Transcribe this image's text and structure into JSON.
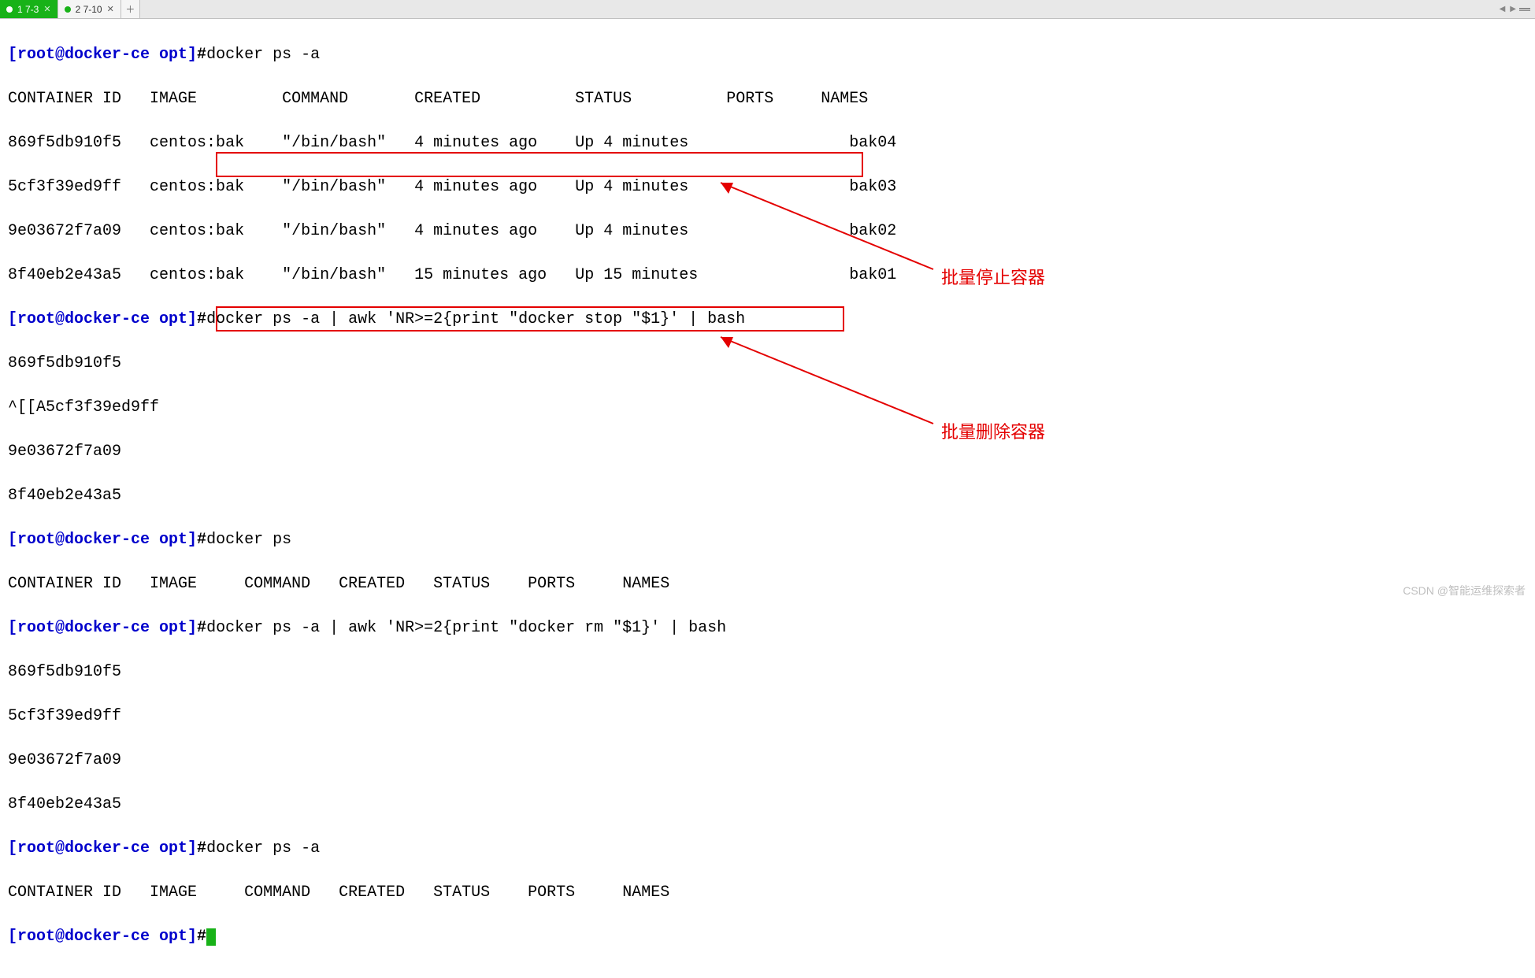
{
  "tabs": {
    "items": [
      {
        "label": "1 7-3",
        "active": true
      },
      {
        "label": "2 7-10",
        "active": false
      }
    ]
  },
  "prompt": "[root@docker-ce opt]",
  "hash": "#",
  "commands": {
    "ps_a_1": "docker ps -a",
    "stop_pipe": "docker ps -a | awk 'NR>=2{print \"docker stop \"$1}' | bash",
    "ps": "docker ps",
    "rm_pipe": "docker ps -a | awk 'NR>=2{print \"docker rm \"$1}' | bash",
    "ps_a_2": "docker ps -a"
  },
  "headers_full": {
    "cid": "CONTAINER ID",
    "image": "IMAGE",
    "cmd": "COMMAND",
    "created": "CREATED",
    "status": "STATUS",
    "ports": "PORTS",
    "names": "NAMES"
  },
  "rows": [
    {
      "cid": "869f5db910f5",
      "image": "centos:bak",
      "cmd": "\"/bin/bash\"",
      "created": "4 minutes ago",
      "status": "Up 4 minutes",
      "ports": "",
      "names": "bak04"
    },
    {
      "cid": "5cf3f39ed9ff",
      "image": "centos:bak",
      "cmd": "\"/bin/bash\"",
      "created": "4 minutes ago",
      "status": "Up 4 minutes",
      "ports": "",
      "names": "bak03"
    },
    {
      "cid": "9e03672f7a09",
      "image": "centos:bak",
      "cmd": "\"/bin/bash\"",
      "created": "4 minutes ago",
      "status": "Up 4 minutes",
      "ports": "",
      "names": "bak02"
    },
    {
      "cid": "8f40eb2e43a5",
      "image": "centos:bak",
      "cmd": "\"/bin/bash\"",
      "created": "15 minutes ago",
      "status": "Up 15 minutes",
      "ports": "",
      "names": "bak01"
    }
  ],
  "stop_output": [
    "869f5db910f5",
    "^[[A5cf3f39ed9ff",
    "9e03672f7a09",
    "8f40eb2e43a5"
  ],
  "rm_output": [
    "869f5db910f5",
    "5cf3f39ed9ff",
    "9e03672f7a09",
    "8f40eb2e43a5"
  ],
  "annotations": {
    "stop": "批量停止容器",
    "rm": "批量删除容器"
  },
  "watermark": "CSDN @智能运维探索者"
}
